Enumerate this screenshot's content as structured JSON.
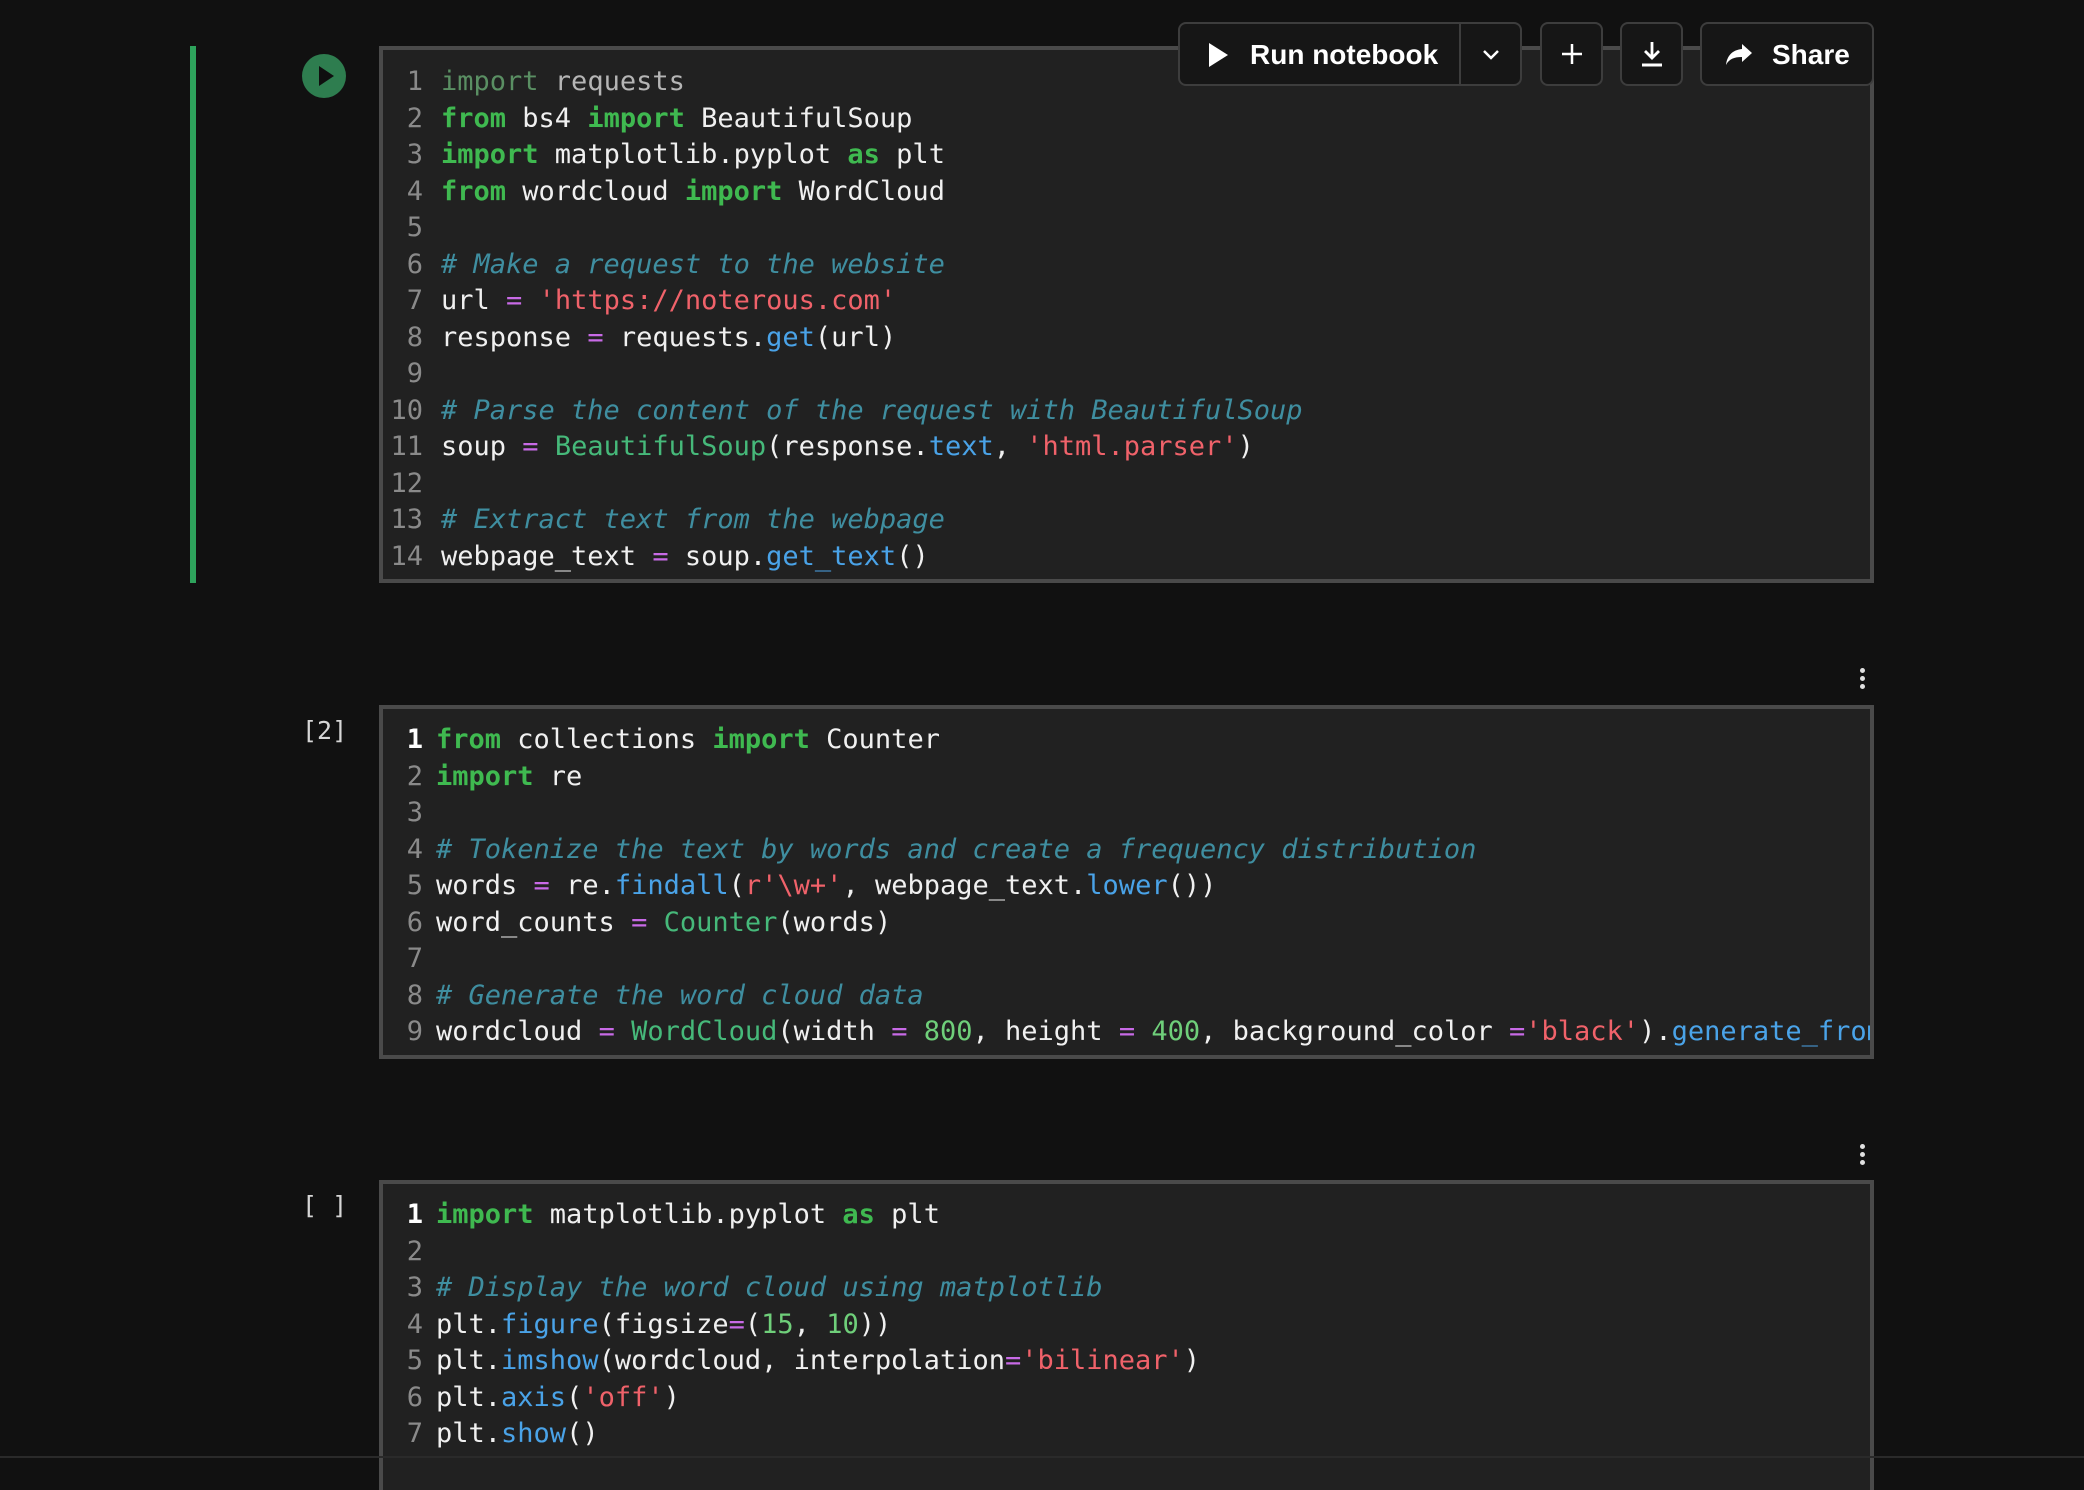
{
  "toolbar": {
    "run_label": "Run notebook",
    "share_label": "Share",
    "icons": [
      "play-icon",
      "chevron-down-icon",
      "plus-icon",
      "download-icon",
      "share-icon"
    ]
  },
  "cells": [
    {
      "exec_label": "",
      "lines": [
        {
          "n": "1",
          "parts": [
            [
              "kw-dim",
              "import"
            ],
            [
              "dim",
              " requests"
            ]
          ]
        },
        {
          "n": "2",
          "parts": [
            [
              "kw",
              "from"
            ],
            [
              "code",
              " bs4 "
            ],
            [
              "kw",
              "import"
            ],
            [
              "code",
              " BeautifulSoup"
            ]
          ]
        },
        {
          "n": "3",
          "parts": [
            [
              "kw",
              "import"
            ],
            [
              "code",
              " matplotlib.pyplot "
            ],
            [
              "kw",
              "as"
            ],
            [
              "code",
              " plt"
            ]
          ]
        },
        {
          "n": "4",
          "parts": [
            [
              "kw",
              "from"
            ],
            [
              "code",
              " wordcloud "
            ],
            [
              "kw",
              "import"
            ],
            [
              "code",
              " WordCloud"
            ]
          ]
        },
        {
          "n": "5",
          "parts": []
        },
        {
          "n": "6",
          "parts": [
            [
              "cm",
              "# Make a request to the website"
            ]
          ]
        },
        {
          "n": "7",
          "parts": [
            [
              "code",
              "url "
            ],
            [
              "op",
              "="
            ],
            [
              "code",
              " "
            ],
            [
              "str",
              "'https://noterous.com'"
            ]
          ]
        },
        {
          "n": "8",
          "parts": [
            [
              "code",
              "response "
            ],
            [
              "op",
              "="
            ],
            [
              "code",
              " requests."
            ],
            [
              "fn",
              "get"
            ],
            [
              "code",
              "(url)"
            ]
          ]
        },
        {
          "n": "9",
          "parts": []
        },
        {
          "n": "10",
          "parts": [
            [
              "cm",
              "# Parse the content of the request with BeautifulSoup"
            ]
          ]
        },
        {
          "n": "11",
          "parts": [
            [
              "code",
              "soup "
            ],
            [
              "op",
              "="
            ],
            [
              "code",
              " "
            ],
            [
              "cls",
              "BeautifulSoup"
            ],
            [
              "code",
              "(response."
            ],
            [
              "fn",
              "text"
            ],
            [
              "code",
              ", "
            ],
            [
              "str",
              "'html.parser'"
            ],
            [
              "code",
              ")"
            ]
          ]
        },
        {
          "n": "12",
          "parts": []
        },
        {
          "n": "13",
          "parts": [
            [
              "cm",
              "# Extract text from the webpage"
            ]
          ]
        },
        {
          "n": "14",
          "parts": [
            [
              "code",
              "webpage_text "
            ],
            [
              "op",
              "="
            ],
            [
              "code",
              " soup."
            ],
            [
              "fn",
              "get_text"
            ],
            [
              "code",
              "()"
            ]
          ]
        }
      ]
    },
    {
      "exec_label": "[2]",
      "lines": [
        {
          "n": "1",
          "parts": [
            [
              "kw",
              "from"
            ],
            [
              "code",
              " collections "
            ],
            [
              "kw",
              "import"
            ],
            [
              "code",
              " Counter"
            ]
          ]
        },
        {
          "n": "2",
          "parts": [
            [
              "kw",
              "import"
            ],
            [
              "code",
              " re"
            ]
          ]
        },
        {
          "n": "3",
          "parts": []
        },
        {
          "n": "4",
          "parts": [
            [
              "cm",
              "# Tokenize the text by words and create a frequency distribution"
            ]
          ]
        },
        {
          "n": "5",
          "parts": [
            [
              "code",
              "words "
            ],
            [
              "op",
              "="
            ],
            [
              "code",
              " re."
            ],
            [
              "fn",
              "findall"
            ],
            [
              "code",
              "("
            ],
            [
              "str",
              "r'\\w+'"
            ],
            [
              "code",
              ", webpage_text."
            ],
            [
              "fn",
              "lower"
            ],
            [
              "code",
              "())"
            ]
          ]
        },
        {
          "n": "6",
          "parts": [
            [
              "code",
              "word_counts "
            ],
            [
              "op",
              "="
            ],
            [
              "code",
              " "
            ],
            [
              "cls",
              "Counter"
            ],
            [
              "code",
              "(words)"
            ]
          ]
        },
        {
          "n": "7",
          "parts": []
        },
        {
          "n": "8",
          "parts": [
            [
              "cm",
              "# Generate the word cloud data"
            ]
          ]
        },
        {
          "n": "9",
          "parts": [
            [
              "code",
              "wordcloud "
            ],
            [
              "op",
              "="
            ],
            [
              "code",
              " "
            ],
            [
              "cls",
              "WordCloud"
            ],
            [
              "code",
              "(width "
            ],
            [
              "op",
              "="
            ],
            [
              "code",
              " "
            ],
            [
              "num",
              "800"
            ],
            [
              "code",
              ", height "
            ],
            [
              "op",
              "="
            ],
            [
              "code",
              " "
            ],
            [
              "num",
              "400"
            ],
            [
              "code",
              ", background_color "
            ],
            [
              "op",
              "="
            ],
            [
              "str",
              "'black'"
            ],
            [
              "code",
              ")."
            ],
            [
              "fn",
              "generate_from_fr"
            ]
          ]
        }
      ]
    },
    {
      "exec_label": "[ ]",
      "lines": [
        {
          "n": "1",
          "parts": [
            [
              "kw",
              "import"
            ],
            [
              "code",
              " matplotlib.pyplot "
            ],
            [
              "kw",
              "as"
            ],
            [
              "code",
              " plt"
            ]
          ]
        },
        {
          "n": "2",
          "parts": []
        },
        {
          "n": "3",
          "parts": [
            [
              "cm",
              "# Display the word cloud using matplotlib"
            ]
          ]
        },
        {
          "n": "4",
          "parts": [
            [
              "code",
              "plt."
            ],
            [
              "fn",
              "figure"
            ],
            [
              "code",
              "(figsize"
            ],
            [
              "op",
              "="
            ],
            [
              "code",
              "("
            ],
            [
              "num",
              "15"
            ],
            [
              "code",
              ", "
            ],
            [
              "num",
              "10"
            ],
            [
              "code",
              "))"
            ]
          ]
        },
        {
          "n": "5",
          "parts": [
            [
              "code",
              "plt."
            ],
            [
              "fn",
              "imshow"
            ],
            [
              "code",
              "(wordcloud, interpolation"
            ],
            [
              "op",
              "="
            ],
            [
              "str",
              "'bilinear'"
            ],
            [
              "code",
              ")"
            ]
          ]
        },
        {
          "n": "6",
          "parts": [
            [
              "code",
              "plt."
            ],
            [
              "fn",
              "axis"
            ],
            [
              "code",
              "("
            ],
            [
              "str",
              "'off'"
            ],
            [
              "code",
              ")"
            ]
          ]
        },
        {
          "n": "7",
          "parts": [
            [
              "code",
              "plt."
            ],
            [
              "fn",
              "show"
            ],
            [
              "code",
              "()"
            ]
          ]
        }
      ]
    }
  ]
}
